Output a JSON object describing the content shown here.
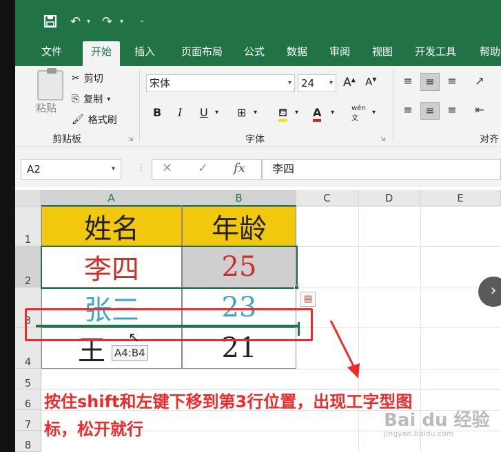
{
  "qat": {
    "save_icon": "save-icon",
    "undo_icon": "undo-icon",
    "redo_icon": "redo-icon"
  },
  "tabs": [
    {
      "label": "文件"
    },
    {
      "label": "开始"
    },
    {
      "label": "插入"
    },
    {
      "label": "页面布局"
    },
    {
      "label": "公式"
    },
    {
      "label": "数据"
    },
    {
      "label": "审阅"
    },
    {
      "label": "视图"
    },
    {
      "label": "开发工具"
    },
    {
      "label": "帮助"
    }
  ],
  "clipboard": {
    "paste_label": "粘贴",
    "cut_label": "剪切",
    "copy_label": "复制",
    "format_painter_label": "格式刷",
    "group_label": "剪贴板"
  },
  "font": {
    "font_name": "宋体",
    "font_size": "24",
    "group_label": "字体",
    "bold": "B",
    "italic": "I",
    "underline": "U",
    "grow": "A",
    "shrink": "A",
    "font_color": "A",
    "phonetic": "wén"
  },
  "alignment": {
    "group_label": "对齐"
  },
  "formula_bar": {
    "name_box": "A2",
    "cancel": "✕",
    "enter": "✓",
    "fx": "fx",
    "formula": "李四"
  },
  "columns": [
    "A",
    "B",
    "C",
    "D",
    "E"
  ],
  "rows": [
    "1",
    "2",
    "3",
    "4",
    "5",
    "6",
    "7",
    "8"
  ],
  "cells": {
    "A1": "姓名",
    "B1": "年龄",
    "A2": "李四",
    "B2": "25",
    "A3": "张三",
    "B3": "23",
    "A4": "王",
    "B4": "21"
  },
  "drag_tooltip": "A4:B4",
  "annotation": "按住shift和左键下移到第3行位置，出现工字型图标，松开就行",
  "watermark": {
    "brand": "Bai du 经验",
    "url": "jingyan.baidu.com"
  },
  "colors": {
    "excel_green": "#217346",
    "header_yellow": "#f2c80f",
    "annotation_red": "#ee2a2a",
    "text_red": "#c8302a",
    "text_blue": "#3fa5c7"
  }
}
